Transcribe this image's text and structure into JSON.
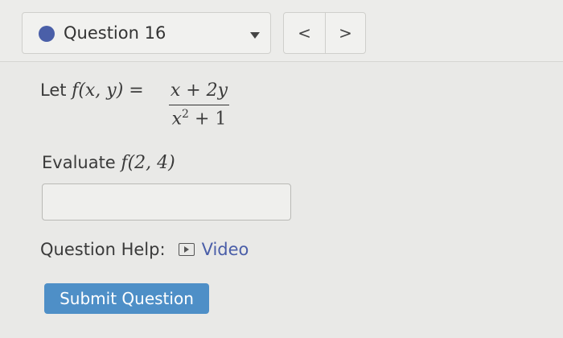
{
  "header": {
    "question_label": "Question 16",
    "prev_label": "<",
    "next_label": ">"
  },
  "problem": {
    "stem_prefix": "Let",
    "function_lhs": "f(x, y) =",
    "numerator": "x + 2y",
    "denominator_base": "x",
    "denominator_exp": "2",
    "denominator_rest": " + 1",
    "evaluate_prefix": "Evaluate",
    "evaluate_expr": "f(2, 4)"
  },
  "answer": {
    "value": ""
  },
  "help": {
    "label": "Question Help:",
    "video_label": "Video"
  },
  "submit": {
    "label": "Submit Question"
  },
  "colors": {
    "accent": "#4a5fa8",
    "submit_bg": "#4e8fc7",
    "link": "#4a5ea8",
    "background": "#e9e9e7"
  },
  "icons": {
    "status": "filled-circle-icon",
    "dropdown": "caret-down-icon",
    "video": "play-box-icon"
  }
}
